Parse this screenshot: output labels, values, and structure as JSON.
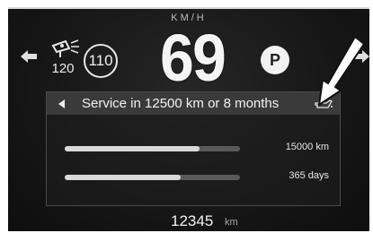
{
  "header": {
    "speed_unit": "KM/H",
    "speed": "69"
  },
  "camera": {
    "icon": "speed-camera-icon",
    "limit_label": "120"
  },
  "speed_limit": {
    "value": "110"
  },
  "gear": {
    "value": "P"
  },
  "service": {
    "message": "Service in 12500 km or 8 months",
    "icon": "oil-can-icon",
    "distance_bar": {
      "label": "15000 km",
      "fill_fraction": 0.77
    },
    "time_bar": {
      "label": "365 days",
      "fill_fraction": 0.66
    }
  },
  "odometer": {
    "value": "12345",
    "unit": "km"
  },
  "colors": {
    "background": "#1a1a1a",
    "bar_fill": "#d9d9d9",
    "bar_track": "#5a5a5a",
    "text": "#f2f2f2"
  }
}
